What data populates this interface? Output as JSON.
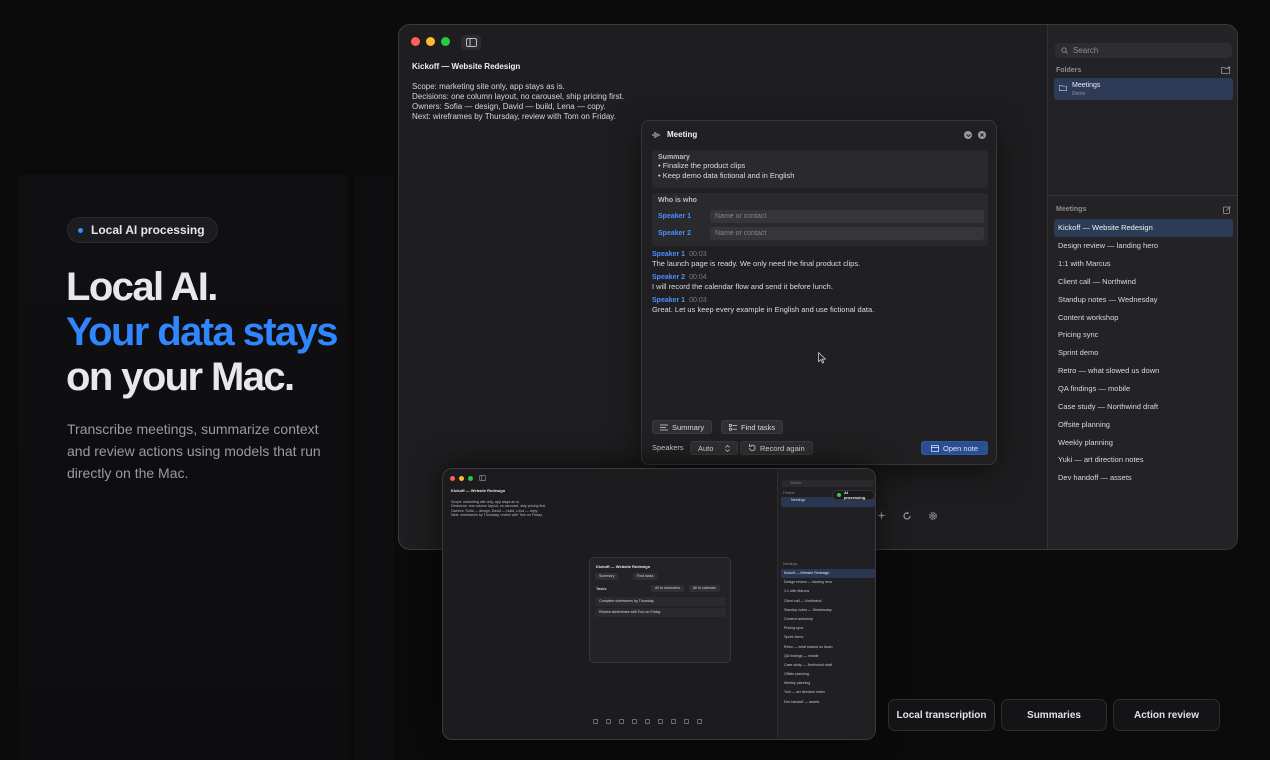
{
  "hero": {
    "badge": "Local AI processing",
    "headline_1": "Local AI.",
    "headline_2": "Your data stays",
    "headline_3": "on your Mac.",
    "description": "Transcribe meetings, summarize context and review actions using models that run directly on the Mac."
  },
  "note": {
    "title": "Kickoff — Website Redesign",
    "lines": [
      "Scope: marketing site only, app stays as is.",
      "Decisions: one column layout, no carousel, ship pricing first.",
      "Owners: Sofia — design, David — build, Lena — copy.",
      "Next: wireframes by Thursday, review with Tom on Friday."
    ]
  },
  "sidebar": {
    "search_placeholder": "Search",
    "folders_label": "Folders",
    "folder": {
      "name": "Meetings",
      "sub": "Demo"
    },
    "meetings_label": "Meetings",
    "meetings": [
      "Kickoff — Website Redesign",
      "Design review — landing hero",
      "1:1 with Marcus",
      "Client call — Northwind",
      "Standup notes — Wednesday",
      "Content workshop",
      "Pricing sync",
      "Sprint demo",
      "Retro — what slowed us down",
      "QA findings — mobile",
      "Case study — Northwind draft",
      "Offsite planning",
      "Weekly planning",
      "Yuki — art direction notes",
      "Dev handoff — assets"
    ]
  },
  "panel": {
    "title": "Meeting",
    "summary_label": "Summary",
    "summary": [
      "• Finalize the product clips",
      "• Keep demo data fictional and in English"
    ],
    "who_label": "Who is who",
    "speakers": [
      {
        "name": "Speaker 1",
        "placeholder": "Name or contact"
      },
      {
        "name": "Speaker 2",
        "placeholder": "Name or contact"
      }
    ],
    "transcript": [
      {
        "speaker": "Speaker 1",
        "time": "00:03",
        "text": "The launch page is ready. We only need the final product clips."
      },
      {
        "speaker": "Speaker 2",
        "time": "00:04",
        "text": "I will record the calendar flow and send it before lunch."
      },
      {
        "speaker": "Speaker 1",
        "time": "00:03",
        "text": "Great. Let us keep every example in English and use fictional data."
      }
    ],
    "summary_btn": "Summary",
    "tasks_btn": "Find tasks",
    "speakers_label": "Speakers",
    "speakers_value": "Auto",
    "record_btn": "Record again",
    "open_btn": "Open note"
  },
  "mini": {
    "badge": "AI processing",
    "panel_title": "Kickoff — Website Redesign",
    "tasks_label": "Tasks",
    "all_reminders": "All to reminders",
    "all_calendar": "All to calendar",
    "tasks": [
      "Complete wireframes by Thursday",
      "Review wireframes with Tom on Friday"
    ]
  },
  "features": [
    "Local transcription",
    "Summaries",
    "Action review"
  ],
  "colors": {
    "accent": "#2f86ff",
    "selection": "#2d3b57",
    "primary_button": "#2a4f91"
  }
}
